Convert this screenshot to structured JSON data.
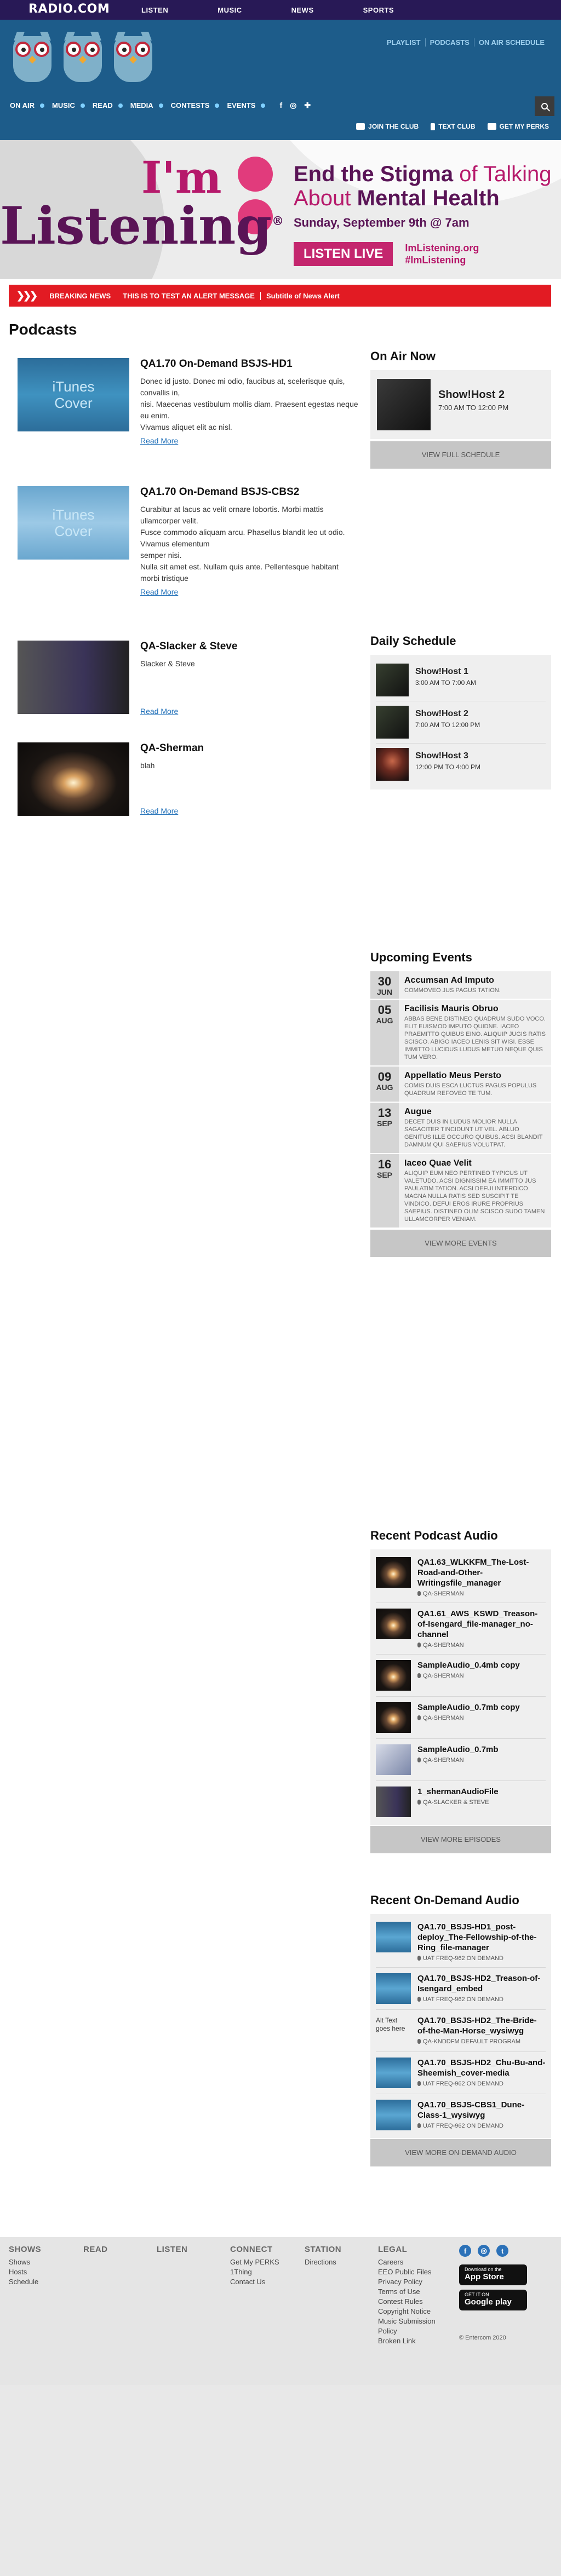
{
  "top_bar": {
    "logo": "RADIO.COM",
    "nav": [
      "LISTEN",
      "MUSIC",
      "NEWS",
      "SPORTS"
    ]
  },
  "station": {
    "links": [
      "PLAYLIST",
      "PODCASTS",
      "ON AIR SCHEDULE"
    ],
    "nav": [
      "ON AIR",
      "MUSIC",
      "READ",
      "MEDIA",
      "CONTESTS",
      "EVENTS"
    ],
    "social": [
      "f",
      "◎",
      "✚"
    ],
    "perks": [
      "JOIN THE CLUB",
      "TEXT CLUB",
      "GET MY PERKS"
    ]
  },
  "hero": {
    "im": "I'm",
    "listening": "Listening",
    "registered": "®",
    "head_line1_a": "End the Stigma",
    "head_line1_b": " of Talking",
    "head_line2_a": "About ",
    "head_line2_b": "Mental Health",
    "date": "Sunday, September 9th @ 7am",
    "cta": "LISTEN LIVE",
    "tag1": "ImListening.org",
    "tag2": "#ImListening"
  },
  "breaking": {
    "label": "BREAKING NEWS",
    "message": "THIS IS TO TEST AN ALERT MESSAGE",
    "subtitle": "Subtitle of News Alert"
  },
  "page_title": "Podcasts",
  "podcasts": [
    {
      "title": "QA1.70 On-Demand BSJS-HD1",
      "thumb_text": "iTunes\nCover",
      "desc": "Donec id justo. Donec mi odio, faucibus at, scelerisque quis, convallis in,\nnisi. Maecenas vestibulum mollis diam. Praesent egestas neque eu enim.\nVivamus aliquet elit ac nisl.",
      "more": "Read More"
    },
    {
      "title": "QA1.70 On-Demand BSJS-CBS2",
      "thumb_text": "iTunes\nCover",
      "desc": "Curabitur at lacus ac velit ornare lobortis. Morbi mattis ullamcorper velit.\nFusce commodo aliquam arcu. Phasellus blandit leo ut odio. Vivamus elementum\nsemper nisi.\nNulla sit amet est. Nullam quis ante. Pellentesque habitant morbi tristique",
      "more": "Read More"
    },
    {
      "title": "QA-Slacker & Steve",
      "desc": "Slacker & Steve",
      "more": "Read More"
    },
    {
      "title": "QA-Sherman",
      "desc": "blah",
      "more": "Read More"
    }
  ],
  "on_air": {
    "heading": "On Air Now",
    "show": "Show!Host 2",
    "time": "7:00 AM TO 12:00 PM",
    "button": "VIEW FULL SCHEDULE"
  },
  "schedule": {
    "heading": "Daily Schedule",
    "items": [
      {
        "name": "Show!Host 1",
        "time": "3:00 AM TO 7:00 AM"
      },
      {
        "name": "Show!Host 2",
        "time": "7:00 AM TO 12:00 PM"
      },
      {
        "name": "Show!Host 3",
        "time": "12:00 PM TO 4:00 PM"
      }
    ]
  },
  "events": {
    "heading": "Upcoming Events",
    "items": [
      {
        "day": "30",
        "month": "JUN",
        "name": "Accumsan Ad Imputo",
        "desc": "COMMOVEO JUS PAGUS TATION."
      },
      {
        "day": "05",
        "month": "AUG",
        "name": "Facilisis Mauris Obruo",
        "desc": "ABBAS BENE DISTINEO QUADRUM SUDO VOCO. ELIT EUISMOD IMPUTO QUIDNE. IACEO PRAEMITTO QUIBUS EINO. ALIQUIP JUGIS RATIS SCISCO. ABIGO IACEO LENIS SIT WISI. ESSE IMMITTO LUCIDUS LUDUS METUO NEQUE QUIS TUM VERO."
      },
      {
        "day": "09",
        "month": "AUG",
        "name": "Appellatio Meus Persto",
        "desc": "COMIS DUIS ESCA LUCTUS PAGUS POPULUS QUADRUM REFOVEO TE TUM."
      },
      {
        "day": "13",
        "month": "SEP",
        "name": "Augue",
        "desc": "DECET DUIS IN LUDUS MOLIOR NULLA SAGACITER TINCIDUNT UT VEL. ABLUO GENITUS ILLE OCCURO QUIBUS. ACSI BLANDIT DAMNUM QUI SAEPIUS VOLUTPAT."
      },
      {
        "day": "16",
        "month": "SEP",
        "name": "Iaceo Quae Velit",
        "desc": "ALIQUIP EUM NEO PERTINEO TYPICUS UT VALETUDO. ACSI DIGNISSIM EA IMMITTO JUS PAULATIM TATION. ACSI DEFUI INTERDICO MAGNA NULLA RATIS SED SUSCIPIT TE VINDICO. DEFUI EROS IRURE PROPRIUS SAEPIUS. DISTINEO OLIM SCISCO SUDO TAMEN ULLAMCORPER VENIAM."
      }
    ],
    "button": "VIEW MORE EVENTS"
  },
  "recent_podcast": {
    "heading": "Recent Podcast Audio",
    "items": [
      {
        "title": "QA1.63_WLKKFM_The-Lost-Road-and-Other-Writingsfile_manager",
        "sub": "QA-SHERMAN"
      },
      {
        "title": "QA1.61_AWS_KSWD_Treason-of-Isengard_file-manager_no-channel",
        "sub": "QA-SHERMAN"
      },
      {
        "title": "SampleAudio_0.4mb copy",
        "sub": "QA-SHERMAN"
      },
      {
        "title": "SampleAudio_0.7mb copy",
        "sub": "QA-SHERMAN"
      },
      {
        "title": "SampleAudio_0.7mb",
        "sub": "QA-SHERMAN"
      },
      {
        "title": "1_shermanAudioFile",
        "sub": "QA-SLACKER & STEVE"
      }
    ],
    "button": "VIEW MORE EPISODES"
  },
  "recent_ondemand": {
    "heading": "Recent On-Demand Audio",
    "items": [
      {
        "title": "QA1.70_BSJS-HD1_post-deploy_The-Fellowship-of-the-Ring_file-manager",
        "sub": "UAT FREQ-962 ON DEMAND"
      },
      {
        "title": "QA1.70_BSJS-HD2_Treason-of-Isengard_embed",
        "sub": "UAT FREQ-962 ON DEMAND"
      },
      {
        "title": "QA1.70_BSJS-HD2_The-Bride-of-the-Man-Horse_wysiwyg",
        "sub": "QA-KNDDFM DEFAULT PROGRAM",
        "alt": "Alt Text goes here"
      },
      {
        "title": "QA1.70_BSJS-HD2_Chu-Bu-and-Sheemish_cover-media",
        "sub": "UAT FREQ-962 ON DEMAND"
      },
      {
        "title": "QA1.70_BSJS-CBS1_Dune-Class-1_wysiwyg",
        "sub": "UAT FREQ-962 ON DEMAND"
      }
    ],
    "button": "VIEW MORE ON-DEMAND AUDIO"
  },
  "footer": {
    "cols": [
      {
        "heading": "SHOWS",
        "links": [
          "Shows",
          "Hosts",
          "Schedule"
        ]
      },
      {
        "heading": "READ",
        "links": []
      },
      {
        "heading": "LISTEN",
        "links": []
      },
      {
        "heading": "CONNECT",
        "links": [
          "Get My PERKS",
          "1Thing",
          "Contact Us"
        ]
      },
      {
        "heading": "STATION",
        "links": [
          "Directions"
        ]
      },
      {
        "heading": "LEGAL",
        "links": [
          "Careers",
          "EEO Public Files",
          "Privacy Policy",
          "Terms of Use",
          "Contest Rules",
          "Copyright Notice",
          "Music Submission Policy",
          "Broken Link"
        ]
      }
    ],
    "social": [
      "f",
      "◎",
      "t"
    ],
    "appstore_small": "Download on the",
    "appstore_big": "App Store",
    "googleplay_small": "GET IT ON",
    "googleplay_big": "Google play",
    "copyright": "© Entercom 2020"
  },
  "colors": {
    "top_bar": "#281956",
    "header": "#1d5c8a",
    "breaking": "#e21b23",
    "link": "#1f6fb8",
    "hero_magenta": "#b6196b",
    "hero_purple": "#5a1456"
  }
}
